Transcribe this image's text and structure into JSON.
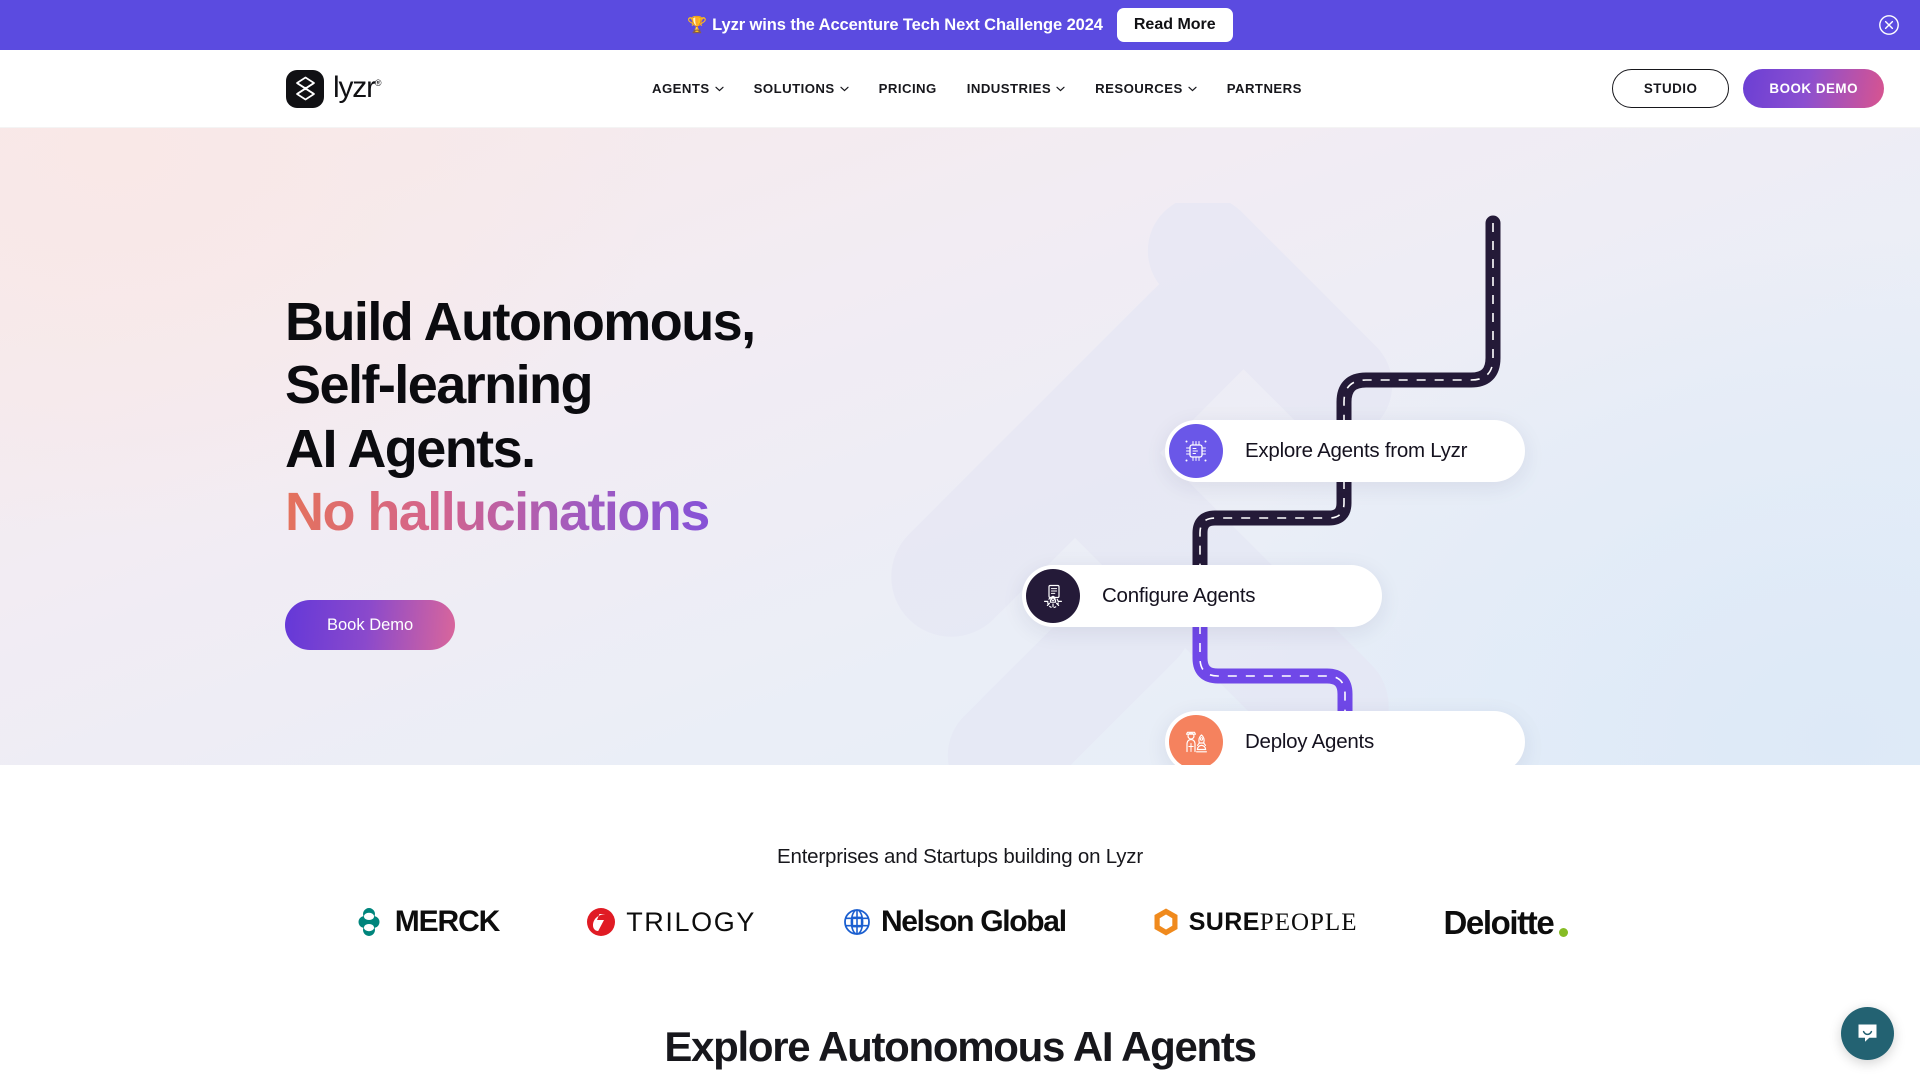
{
  "banner": {
    "emoji": "🏆",
    "text": "Lyzr wins the Accenture Tech Next Challenge 2024",
    "button_label": "Read More",
    "close_icon": "close-circle-icon",
    "background_color": "#5B4BE0"
  },
  "header": {
    "logo": {
      "wordmark": "lyzr",
      "trademark": "®",
      "mark_icon": "lyzr-hourglass-icon"
    },
    "nav": [
      {
        "label": "AGENTS",
        "has_dropdown": true
      },
      {
        "label": "SOLUTIONS",
        "has_dropdown": true
      },
      {
        "label": "PRICING",
        "has_dropdown": false
      },
      {
        "label": "INDUSTRIES",
        "has_dropdown": true
      },
      {
        "label": "RESOURCES",
        "has_dropdown": true
      },
      {
        "label": "PARTNERS",
        "has_dropdown": false
      }
    ],
    "studio_label": "STUDIO",
    "book_demo_label": "BOOK DEMO"
  },
  "hero": {
    "heading_line1": "Build Autonomous,",
    "heading_line2": "Self-learning",
    "heading_line3": "AI Agents.",
    "heading_gradient": "No hallucinations",
    "cta_label": "Book Demo",
    "gradient_start": "#E4725C",
    "gradient_end": "#7C4FE0",
    "flow": [
      {
        "label": "Explore Agents from Lyzr",
        "icon": "chip-ai-icon",
        "icon_bg": "#6A57E8"
      },
      {
        "label": "Configure Agents",
        "icon": "gear-document-icon",
        "icon_bg": "#241A38"
      },
      {
        "label": "Deploy Agents",
        "icon": "person-rocket-icon",
        "icon_bg": "#F5825E"
      }
    ]
  },
  "proof": {
    "title": "Enterprises and Startups building on Lyzr",
    "logos": [
      {
        "name": "MERCK",
        "mark": "merck-clover-icon",
        "mark_color": "#00857C"
      },
      {
        "name": "TRILOGY",
        "mark": "trilogy-swirl-icon",
        "mark_color": "#E01B24"
      },
      {
        "name": "Nelson Global",
        "mark": "nelson-globe-icon",
        "mark_color": "#1B5FD0"
      },
      {
        "name": "SUREPEOPLE",
        "mark": "surepeople-hex-icon",
        "mark_color": "#F08A1D"
      },
      {
        "name": "Deloitte",
        "mark": "deloitte-dot-icon",
        "mark_color": "#86BC25"
      }
    ]
  },
  "section": {
    "heading": "Explore Autonomous AI Agents"
  },
  "chat": {
    "icon": "chat-bubble-smile-icon",
    "color": "#236272"
  }
}
